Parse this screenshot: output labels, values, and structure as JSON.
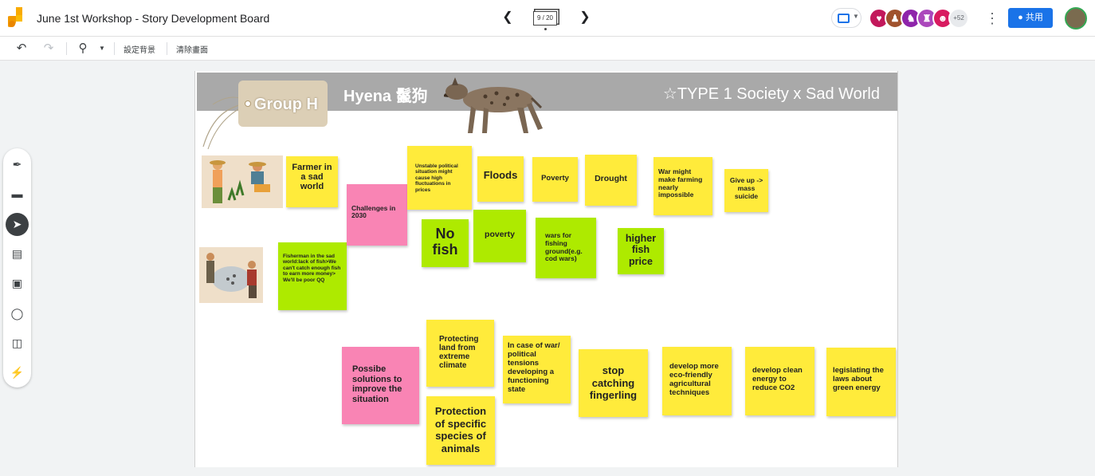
{
  "header": {
    "title": "June 1st Workshop - Story Development Board",
    "frame_counter": "9 / 20",
    "avatar_count": "+52",
    "share_label": "共用"
  },
  "toolbar": {
    "set_background": "設定背景",
    "clear_frame": "清除畫面"
  },
  "board": {
    "tag_label": "Group H",
    "title": "Hyena 鬣狗",
    "subtitle": "☆TYPE 1 Society x Sad World"
  },
  "notes": {
    "farmer": "Farmer in a sad world",
    "fisherman": "Fisherman in the sad world:lack of fish>We can't catch enough fish to earn more money> We'll be poor QQ",
    "challenges": "Challenges in 2030",
    "unstable": "Unstable political situation might cause high fluctuations in prices",
    "floods": "Floods",
    "poverty1": "Poverty",
    "drought": "Drought",
    "war_farming": "War might make farming nearly impossible",
    "give_up": "Give up -> mass suicide",
    "no_fish": "No fish",
    "poverty2": "poverty",
    "wars_fishing": "wars for fishing ground(e.g. cod wars)",
    "higher_price": "higher fish price",
    "solutions": "Possibe solutions to improve the situation",
    "protect_land": "Protecting land from extreme climate",
    "protect_species": "Protection of specific species of animals",
    "war_state": "In case of war/ political tensions developing a functioning state",
    "stop_catching": "stop catching fingerling",
    "eco_agri": "develop more eco-friendly agricultural techniques",
    "clean_energy": "develop clean energy to reduce CO2",
    "legislate": "legislating the laws about green energy"
  },
  "colors": {
    "yellow_note": "#ffeb3b",
    "green_note": "#aeea00",
    "pink_note": "#f984b4",
    "banner": "#a9a9a9",
    "accent": "#1a73e8"
  },
  "icons": {
    "undo": "undo-icon",
    "redo": "redo-icon",
    "zoom": "zoom-icon",
    "pen": "pen-icon",
    "eraser": "eraser-icon",
    "select": "select-pointer-icon",
    "sticky_note": "sticky-note-icon",
    "image": "image-icon",
    "circle": "circle-shape-icon",
    "text_box": "text-box-icon",
    "laser": "laser-icon"
  }
}
